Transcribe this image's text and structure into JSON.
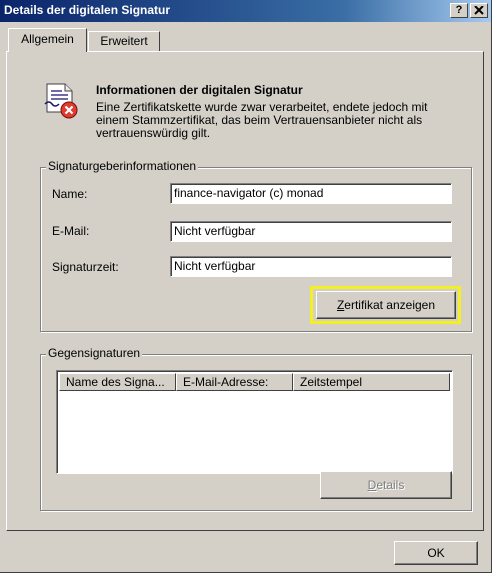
{
  "window": {
    "title": "Details der digitalen Signatur",
    "help_button": "?",
    "close_button": "x"
  },
  "tabs": [
    {
      "label": "Allgemein",
      "active": true
    },
    {
      "label": "Erweitert",
      "active": false
    }
  ],
  "header": {
    "icon": "certificate-error-icon",
    "title": "Informationen der digitalen Signatur",
    "description": "Eine Zertifikatskette wurde zwar verarbeitet, endete jedoch mit einem Stammzertifikat, das beim Vertrauensanbieter nicht als vertrauenswürdig gilt."
  },
  "signer_group": {
    "label": "Signaturgeberinformationen",
    "fields": [
      {
        "label": "Name:",
        "value": "finance-navigator   (c) monad"
      },
      {
        "label": "E-Mail:",
        "value": "Nicht verfügbar"
      },
      {
        "label": "Signaturzeit:",
        "value": "Nicht verfügbar"
      }
    ],
    "view_certificate_button": {
      "mnemonic": "Z",
      "rest": "ertifikat anzeigen"
    }
  },
  "countersign_group": {
    "label": "Gegensignaturen",
    "columns": [
      "Name des Signa...",
      "E-Mail-Adresse:",
      "Zeitstempel"
    ],
    "rows": [],
    "details_button": {
      "mnemonic": "D",
      "rest": "etails"
    }
  },
  "footer": {
    "ok_button": "OK"
  },
  "colors": {
    "titlebar": "#0a246a",
    "dialog_bg": "#d4d0c8",
    "highlight": "#f3f021",
    "error_red": "#e03b2f"
  }
}
